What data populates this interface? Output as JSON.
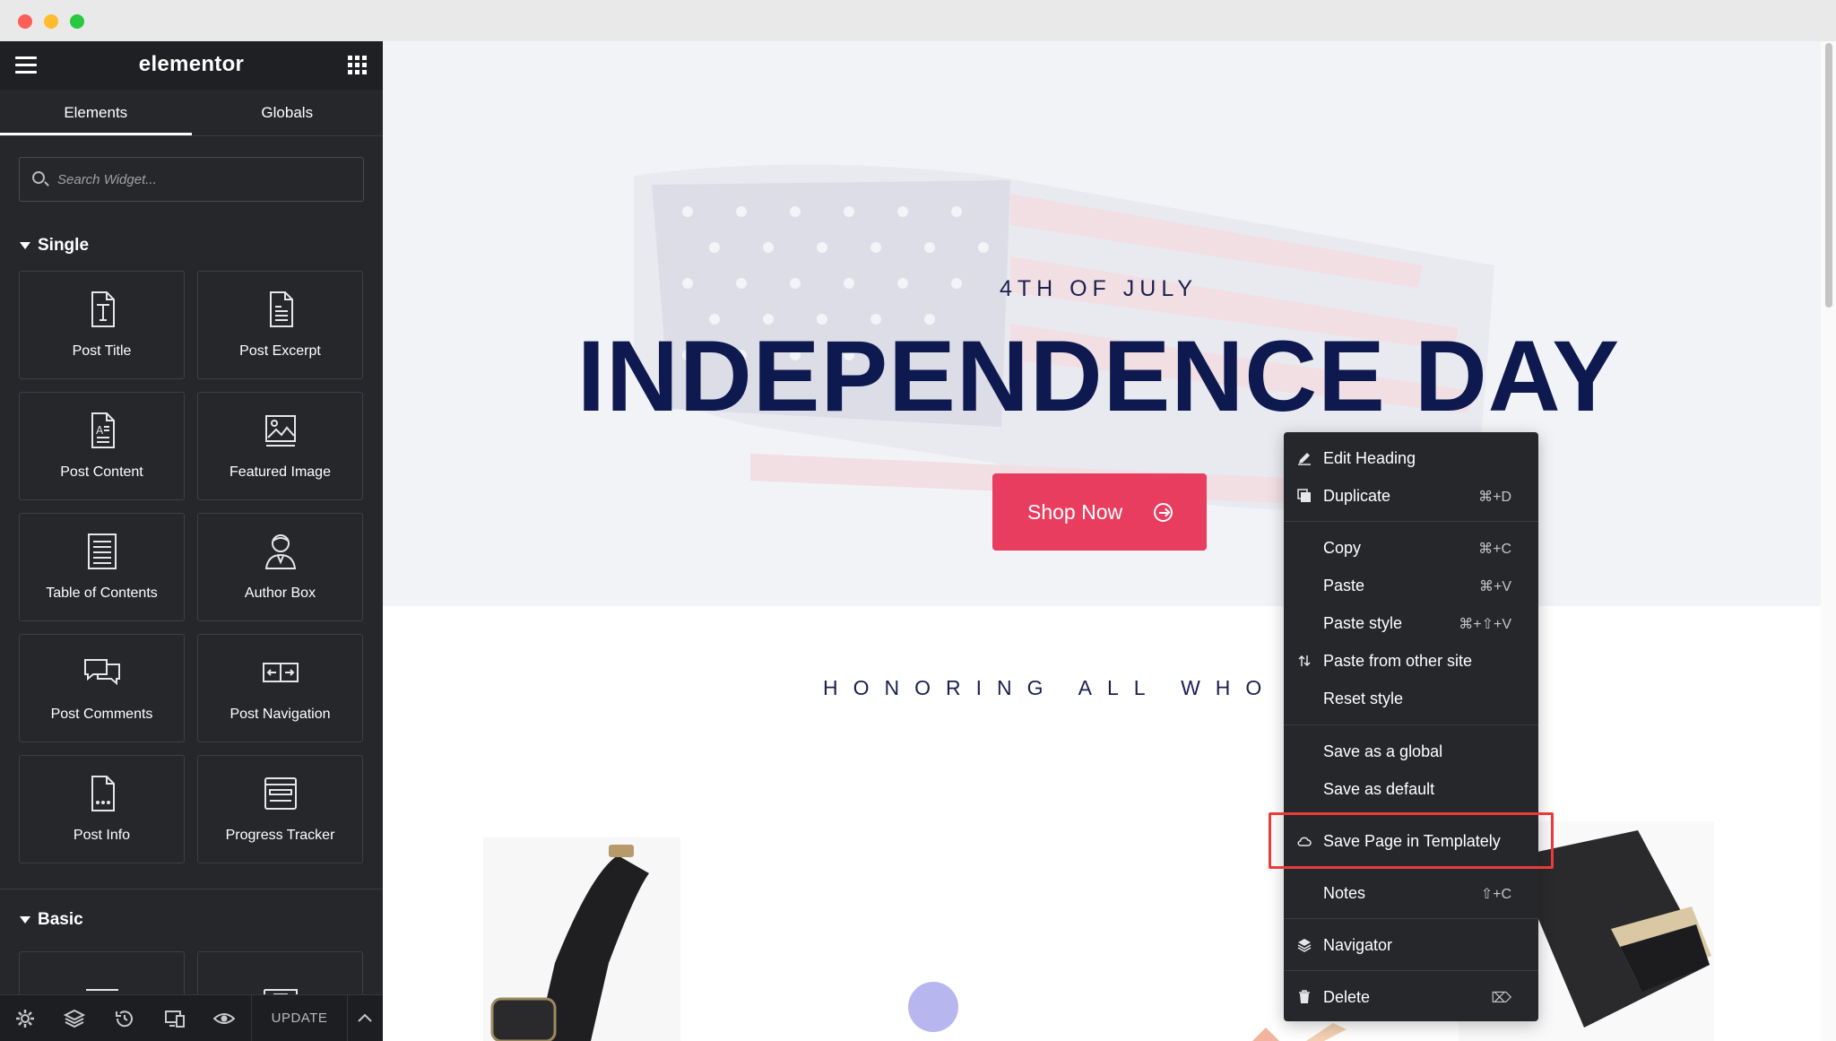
{
  "app": {
    "brand": "elementor"
  },
  "sidebar": {
    "tabs": [
      {
        "label": "Elements"
      },
      {
        "label": "Globals"
      }
    ],
    "search": {
      "placeholder": "Search Widget..."
    },
    "sections": [
      {
        "title": "Single",
        "widgets": [
          {
            "label": "Post Title",
            "icon": "post-title-icon"
          },
          {
            "label": "Post Excerpt",
            "icon": "post-excerpt-icon"
          },
          {
            "label": "Post Content",
            "icon": "post-content-icon"
          },
          {
            "label": "Featured Image",
            "icon": "featured-image-icon"
          },
          {
            "label": "Table of Contents",
            "icon": "table-of-contents-icon"
          },
          {
            "label": "Author Box",
            "icon": "author-box-icon"
          },
          {
            "label": "Post Comments",
            "icon": "post-comments-icon"
          },
          {
            "label": "Post Navigation",
            "icon": "post-navigation-icon"
          },
          {
            "label": "Post Info",
            "icon": "post-info-icon"
          },
          {
            "label": "Progress Tracker",
            "icon": "progress-tracker-icon"
          }
        ]
      },
      {
        "title": "Basic"
      }
    ],
    "bottom": {
      "update_label": "UPDATE"
    }
  },
  "canvas": {
    "eyebrow": "4TH OF JULY",
    "headline": "INDEPENDENCE DAY",
    "cta_label": "Shop Now",
    "honoring": "HONORING ALL WHO SEF"
  },
  "context_menu": {
    "items": [
      {
        "label": "Edit Heading",
        "shortcut": "",
        "icon": "pencil-icon"
      },
      {
        "label": "Duplicate",
        "shortcut": "⌘+D",
        "icon": "duplicate-icon"
      },
      {
        "label": "Copy",
        "shortcut": "⌘+C",
        "icon": ""
      },
      {
        "label": "Paste",
        "shortcut": "⌘+V",
        "icon": ""
      },
      {
        "label": "Paste style",
        "shortcut": "⌘+⇧+V",
        "icon": ""
      },
      {
        "label": "Paste from other site",
        "shortcut": "",
        "icon": "paste-arrows-icon"
      },
      {
        "label": "Reset style",
        "shortcut": "",
        "icon": ""
      },
      {
        "label": "Save as a global",
        "shortcut": "",
        "icon": ""
      },
      {
        "label": "Save as default",
        "shortcut": "",
        "icon": ""
      },
      {
        "label": "Save Page in Templately",
        "shortcut": "",
        "icon": "cloud-icon"
      },
      {
        "label": "Notes",
        "shortcut": "⇧+C",
        "icon": ""
      },
      {
        "label": "Navigator",
        "shortcut": "",
        "icon": "layers-icon"
      },
      {
        "label": "Delete",
        "shortcut": "⌦",
        "icon": "trash-icon"
      }
    ]
  },
  "colors": {
    "sidebar_bg": "#26272b",
    "accent": "#e83d5e",
    "headline": "#0e1a4f",
    "highlight_border": "#e83b3b"
  }
}
